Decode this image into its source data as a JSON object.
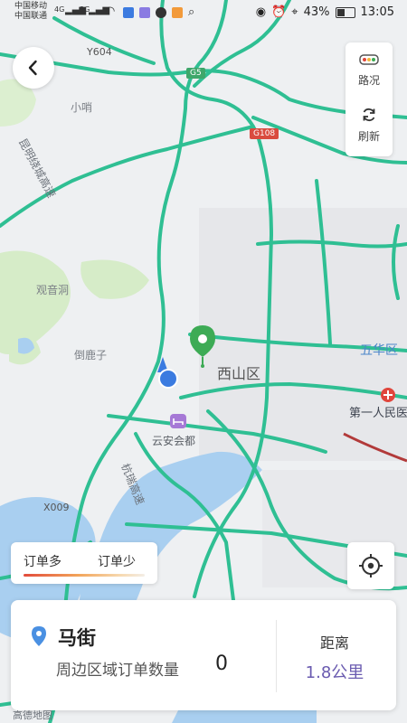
{
  "status_bar": {
    "carrier_1": "中国移动",
    "carrier_2": "中国联通",
    "net_1": "4G",
    "net_2": "3G",
    "battery": "43%",
    "time": "13:05"
  },
  "map": {
    "road_badges": [
      "Y604",
      "G5",
      "G108",
      "X009"
    ],
    "highway_labels": [
      "昆明绕城高速",
      "杭瑞高速"
    ],
    "place_labels": [
      "小哨",
      "观音洞",
      "倒鹿子",
      "西山区",
      "五华区",
      "第一人民医",
      "云安会都"
    ],
    "attribution": "高德地图"
  },
  "controls": {
    "traffic_label": "路况",
    "refresh_label": "刷新"
  },
  "legend": {
    "more_label": "订单多",
    "less_label": "订单少"
  },
  "card": {
    "place_name": "马街",
    "order_count_label": "周边区域订单数量",
    "order_count": "0",
    "distance_label": "距离",
    "distance_value": "1.8公里"
  },
  "colors": {
    "road": "#2fbf93",
    "accent": "#6a5bb0",
    "pin": "#3dab55",
    "location": "#3b7be0",
    "hospital": "#e0463c"
  }
}
